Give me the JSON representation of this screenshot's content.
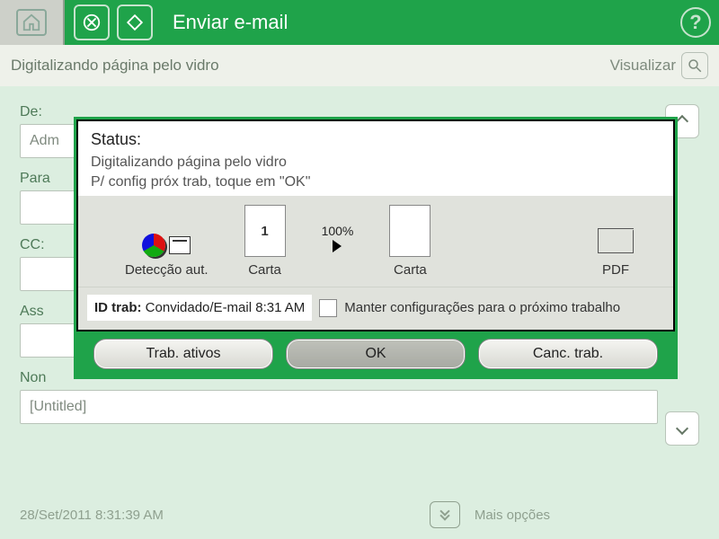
{
  "header": {
    "title": "Enviar e-mail"
  },
  "statusbar": {
    "text": "Digitalizando página pelo vidro",
    "view_label": "Visualizar"
  },
  "form": {
    "from_label": "De:",
    "from_value": "Adm",
    "to_label": "Para",
    "cc_label": "CC:",
    "subject_label": "Ass",
    "name_label": "Non",
    "filename": "[Untitled]"
  },
  "bottom": {
    "timestamp": "28/Set/2011 8:31:39 AM",
    "more_label": "Mais opções"
  },
  "dialog": {
    "status_label": "Status:",
    "status_line1": "Digitalizando página pelo vidro",
    "status_line2": "P/ config próx trab, toque em \"OK\"",
    "detect_label": "Detecção aut.",
    "src_paper": "Carta",
    "dst_paper": "Carta",
    "output_format": "PDF",
    "page_number": "1",
    "percent": "100%",
    "job_id_label": "ID trab:",
    "job_id_value": "Convidado/E-mail 8:31 AM",
    "keep_label": "Manter configurações para o próximo trabalho",
    "btn_active": "Trab. ativos",
    "btn_ok": "OK",
    "btn_cancel": "Canc. trab."
  }
}
